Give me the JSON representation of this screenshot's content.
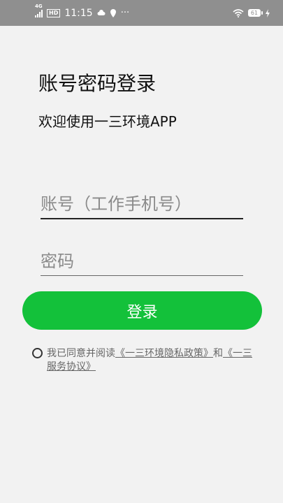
{
  "status_bar": {
    "network": "4G",
    "hd": "HD",
    "time": "11:15",
    "more": "···",
    "battery": "61"
  },
  "header": {
    "title": "账号密码登录",
    "subtitle": "欢迎使用一三环境APP"
  },
  "form": {
    "account_placeholder": "账号（工作手机号）",
    "password_placeholder": "密码",
    "login_label": "登录"
  },
  "agreement": {
    "prefix": "我已同意并阅读",
    "privacy_link": "《一三环境隐私政策》",
    "connector": "和",
    "service_link": "《一三服务协议》"
  },
  "colors": {
    "accent": "#13c13a",
    "status_bar": "#8f8f8f",
    "background": "#f2f2f2"
  }
}
